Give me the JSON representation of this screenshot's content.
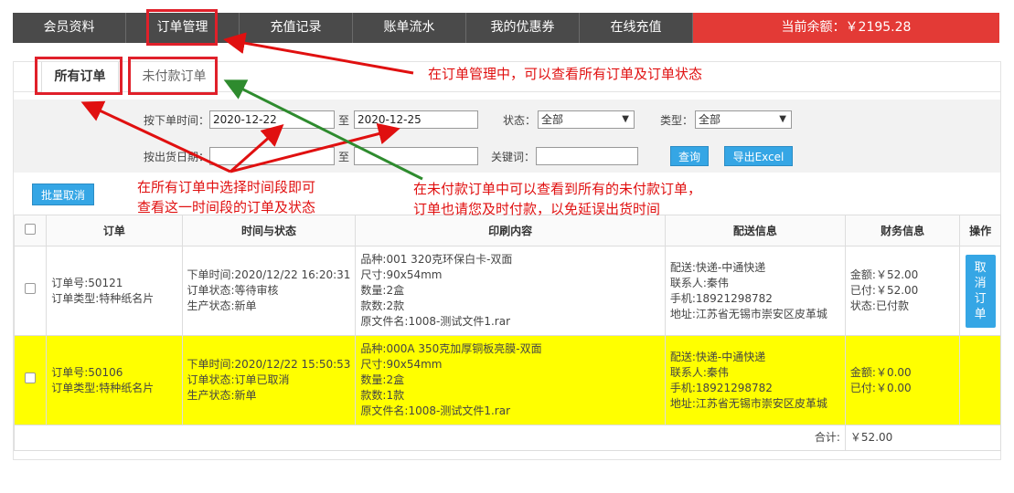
{
  "nav": {
    "items": [
      "会员资料",
      "订单管理",
      "充值记录",
      "账单流水",
      "我的优惠券",
      "在线充值"
    ],
    "balance": "当前余额：￥2195.28"
  },
  "tabs": {
    "all": "所有订单",
    "unpaid": "未付款订单"
  },
  "filter": {
    "order_time_label": "按下单时间：",
    "date_from": "2020-12-22",
    "to": "至",
    "date_to": "2020-12-25",
    "status_label": "状态：",
    "status_value": "全部",
    "type_label": "类型：",
    "type_value": "全部",
    "ship_date_label": "按出货日期：",
    "keyword_label": "关键词：",
    "query_button": "查询",
    "export_button": "导出Excel"
  },
  "batch_cancel": "批量取消",
  "table": {
    "headers": [
      "订单",
      "时间与状态",
      "印刷内容",
      "配送信息",
      "财务信息",
      "操作"
    ],
    "rows": [
      {
        "order_no": "订单号:50121",
        "order_type": "订单类型:特种纸名片",
        "time": "下单时间:2020/12/22 16:20:31",
        "order_status": "订单状态:等待审核",
        "prod_status": "生产状态:新单",
        "variety": "品种:001 320克环保白卡-双面",
        "size": "尺寸:90x54mm",
        "qty": "数量:2盒",
        "kinds": "款数:2款",
        "file": "原文件名:1008-测试文件1.rar",
        "delivery": "配送:快递-中通快递",
        "contact": "联系人:秦伟",
        "phone": "手机:18921298782",
        "address": "地址:江苏省无锡市崇安区皮革城",
        "amount": "金额:￥52.00",
        "paid": "已付:￥52.00",
        "pay_status": "状态:已付款",
        "action": "取消订单"
      },
      {
        "order_no": "订单号:50106",
        "order_type": "订单类型:特种纸名片",
        "time": "下单时间:2020/12/22 15:50:53",
        "order_status": "订单状态:订单已取消",
        "prod_status": "生产状态:新单",
        "variety": "品种:000A 350克加厚铜板亮膜-双面",
        "size": "尺寸:90x54mm",
        "qty": "数量:2盒",
        "kinds": "款数:1款",
        "file": "原文件名:1008-测试文件1.rar",
        "delivery": "配送:快递-中通快递",
        "contact": "联系人:秦伟",
        "phone": "手机:18921298782",
        "address": "地址:江苏省无锡市崇安区皮革城",
        "amount": "金额:￥0.00",
        "paid": "已付:￥0.00"
      }
    ],
    "total_label": "合计:",
    "total_value": "￥52.00"
  },
  "annotations": {
    "order_mgmt": "在订单管理中，可以查看所有订单及订单状态",
    "time_range_line1": "在所有订单中选择时间段即可",
    "time_range_line2": "查看这一时间段的订单及状态",
    "unpaid_line1": "在未付款订单中可以查看到所有的未付款订单，",
    "unpaid_line2": "订单也请您及时付款，以免延误出货时间"
  },
  "colors": {
    "nav_bg": "#4a4a4a",
    "balance_bg": "#e33a36",
    "accent_blue": "#35a6e5",
    "highlight_row": "#ffff00",
    "annotation_red": "#e01010",
    "annotation_green": "#2e8b2e"
  }
}
